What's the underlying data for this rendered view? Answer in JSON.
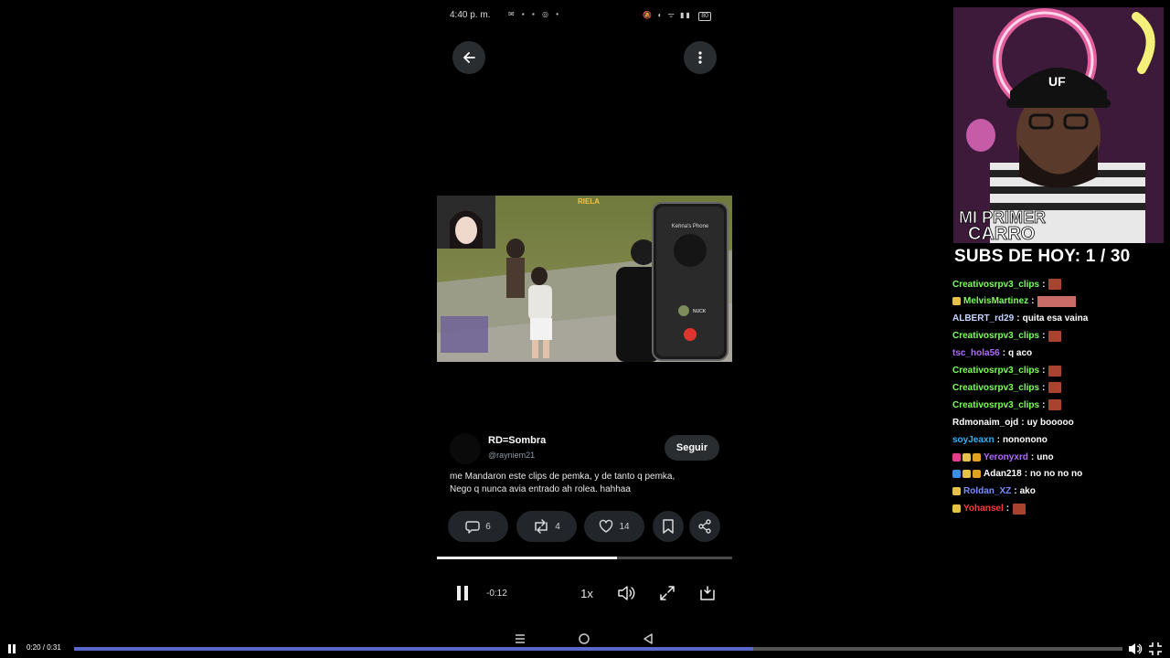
{
  "status_bar": {
    "time": "4:40 p. m.",
    "left_icons": "✉ ▪ ▪ ◎ •",
    "right_icons": "🔕 ◐ ᯤ ▮▮",
    "battery": "80"
  },
  "post": {
    "author_name": "RD=Sombra",
    "author_handle": "@rayniem21",
    "follow_label": "Seguir",
    "text_line1": "me Mandaron  este clips de pemka, y de tanto q pemka,",
    "text_line2": "Nego q nunca avia entrado ah rolea. hahhaa",
    "reply_count": "6",
    "repost_count": "4",
    "like_count": "14",
    "media": {
      "server_logo": "RIELA",
      "phone_call_name": "Kehna's Phone",
      "phone_caller": "NUCK"
    }
  },
  "player": {
    "remaining": "-0:12",
    "speed": "1x",
    "progress_fraction": 0.61
  },
  "overlay": {
    "cam_banner_line1": "MI PRIMER",
    "cam_banner_line2": "CARRO",
    "cap_logo": "UF",
    "subs_goal": "SUBS DE HOY: 1 / 30"
  },
  "chat": [
    {
      "user": "Creativosrpv3_clips",
      "color": "#7cff5a",
      "badges": [],
      "text": "",
      "emote": "small"
    },
    {
      "user": "MelvisMartinez",
      "color": "#7cff5a",
      "badges": [
        "#e6c14a"
      ],
      "text": "",
      "emote": "wide"
    },
    {
      "user": "ALBERT_rd29",
      "color": "#c6d4ff",
      "badges": [],
      "text": "quita esa vaina",
      "emote": ""
    },
    {
      "user": "Creativosrpv3_clips",
      "color": "#7cff5a",
      "badges": [],
      "text": "",
      "emote": "small"
    },
    {
      "user": "tsc_hola56",
      "color": "#b06bff",
      "badges": [],
      "text": "q aco",
      "emote": ""
    },
    {
      "user": "Creativosrpv3_clips",
      "color": "#7cff5a",
      "badges": [],
      "text": "",
      "emote": "small"
    },
    {
      "user": "Creativosrpv3_clips",
      "color": "#7cff5a",
      "badges": [],
      "text": "",
      "emote": "small"
    },
    {
      "user": "Creativosrpv3_clips",
      "color": "#7cff5a",
      "badges": [],
      "text": "",
      "emote": "small"
    },
    {
      "user": "Rdmonaim_ojd",
      "color": "#ffffff",
      "badges": [],
      "text": "uy booooo",
      "emote": ""
    },
    {
      "user": "soyJeaxn",
      "color": "#2fb3ff",
      "badges": [],
      "text": "nononono",
      "emote": ""
    },
    {
      "user": "Yeronyxrd",
      "color": "#b06bff",
      "badges": [
        "#e0408a",
        "#e6c14a",
        "#e0a020"
      ],
      "text": "uno",
      "emote": ""
    },
    {
      "user": "Adan218",
      "color": "#ffffff",
      "badges": [
        "#3a8ee6",
        "#e6c14a",
        "#e0a020"
      ],
      "text": "no no no no",
      "emote": ""
    },
    {
      "user": "Roldan_XZ",
      "color": "#7a8cff",
      "badges": [
        "#e6c14a"
      ],
      "text": "ako",
      "emote": ""
    },
    {
      "user": "Yohansel",
      "color": "#ff3a3a",
      "badges": [
        "#e6c14a"
      ],
      "text": "",
      "emote": "small"
    }
  ],
  "video": {
    "time": "0:20 / 0:31",
    "progress_fraction": 0.648
  }
}
